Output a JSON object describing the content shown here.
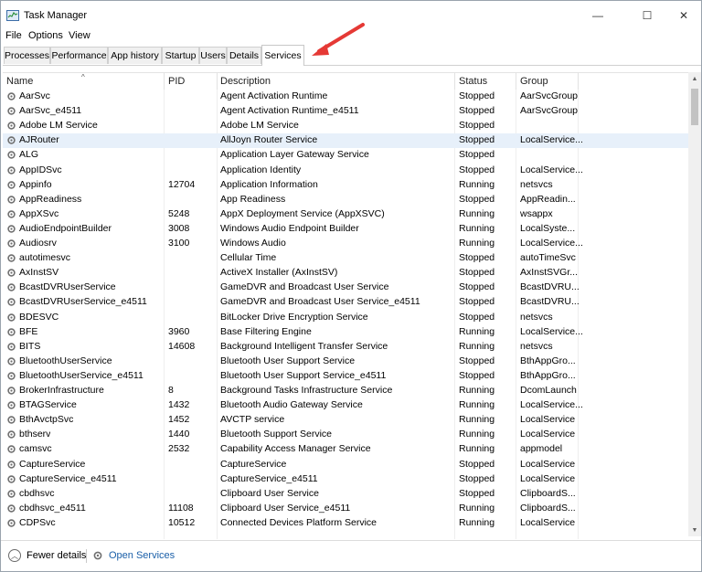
{
  "window": {
    "title": "Task Manager",
    "controls": {
      "minimize": "—",
      "maximize": "☐",
      "close": "✕"
    }
  },
  "menu": [
    "File",
    "Options",
    "View"
  ],
  "tabs": [
    "Processes",
    "Performance",
    "App history",
    "Startup",
    "Users",
    "Details",
    "Services"
  ],
  "active_tab": "Services",
  "columns": {
    "name": "Name",
    "pid": "PID",
    "description": "Description",
    "status": "Status",
    "group": "Group"
  },
  "services": [
    {
      "name": "AarSvc",
      "pid": "",
      "description": "Agent Activation Runtime",
      "status": "Stopped",
      "group": "AarSvcGroup"
    },
    {
      "name": "AarSvc_e4511",
      "pid": "",
      "description": "Agent Activation Runtime_e4511",
      "status": "Stopped",
      "group": "AarSvcGroup"
    },
    {
      "name": "Adobe LM Service",
      "pid": "",
      "description": "Adobe LM Service",
      "status": "Stopped",
      "group": ""
    },
    {
      "name": "AJRouter",
      "pid": "",
      "description": "AllJoyn Router Service",
      "status": "Stopped",
      "group": "LocalService..."
    },
    {
      "name": "ALG",
      "pid": "",
      "description": "Application Layer Gateway Service",
      "status": "Stopped",
      "group": ""
    },
    {
      "name": "AppIDSvc",
      "pid": "",
      "description": "Application Identity",
      "status": "Stopped",
      "group": "LocalService..."
    },
    {
      "name": "Appinfo",
      "pid": "12704",
      "description": "Application Information",
      "status": "Running",
      "group": "netsvcs"
    },
    {
      "name": "AppReadiness",
      "pid": "",
      "description": "App Readiness",
      "status": "Stopped",
      "group": "AppReadin..."
    },
    {
      "name": "AppXSvc",
      "pid": "5248",
      "description": "AppX Deployment Service (AppXSVC)",
      "status": "Running",
      "group": "wsappx"
    },
    {
      "name": "AudioEndpointBuilder",
      "pid": "3008",
      "description": "Windows Audio Endpoint Builder",
      "status": "Running",
      "group": "LocalSyste..."
    },
    {
      "name": "Audiosrv",
      "pid": "3100",
      "description": "Windows Audio",
      "status": "Running",
      "group": "LocalService..."
    },
    {
      "name": "autotimesvc",
      "pid": "",
      "description": "Cellular Time",
      "status": "Stopped",
      "group": "autoTimeSvc"
    },
    {
      "name": "AxInstSV",
      "pid": "",
      "description": "ActiveX Installer (AxInstSV)",
      "status": "Stopped",
      "group": "AxInstSVGr..."
    },
    {
      "name": "BcastDVRUserService",
      "pid": "",
      "description": "GameDVR and Broadcast User Service",
      "status": "Stopped",
      "group": "BcastDVRU..."
    },
    {
      "name": "BcastDVRUserService_e4511",
      "pid": "",
      "description": "GameDVR and Broadcast User Service_e4511",
      "status": "Stopped",
      "group": "BcastDVRU..."
    },
    {
      "name": "BDESVC",
      "pid": "",
      "description": "BitLocker Drive Encryption Service",
      "status": "Stopped",
      "group": "netsvcs"
    },
    {
      "name": "BFE",
      "pid": "3960",
      "description": "Base Filtering Engine",
      "status": "Running",
      "group": "LocalService..."
    },
    {
      "name": "BITS",
      "pid": "14608",
      "description": "Background Intelligent Transfer Service",
      "status": "Running",
      "group": "netsvcs"
    },
    {
      "name": "BluetoothUserService",
      "pid": "",
      "description": "Bluetooth User Support Service",
      "status": "Stopped",
      "group": "BthAppGro..."
    },
    {
      "name": "BluetoothUserService_e4511",
      "pid": "",
      "description": "Bluetooth User Support Service_e4511",
      "status": "Stopped",
      "group": "BthAppGro..."
    },
    {
      "name": "BrokerInfrastructure",
      "pid": "8",
      "description": "Background Tasks Infrastructure Service",
      "status": "Running",
      "group": "DcomLaunch"
    },
    {
      "name": "BTAGService",
      "pid": "1432",
      "description": "Bluetooth Audio Gateway Service",
      "status": "Running",
      "group": "LocalService..."
    },
    {
      "name": "BthAvctpSvc",
      "pid": "1452",
      "description": "AVCTP service",
      "status": "Running",
      "group": "LocalService"
    },
    {
      "name": "bthserv",
      "pid": "1440",
      "description": "Bluetooth Support Service",
      "status": "Running",
      "group": "LocalService"
    },
    {
      "name": "camsvc",
      "pid": "2532",
      "description": "Capability Access Manager Service",
      "status": "Running",
      "group": "appmodel"
    },
    {
      "name": "CaptureService",
      "pid": "",
      "description": "CaptureService",
      "status": "Stopped",
      "group": "LocalService"
    },
    {
      "name": "CaptureService_e4511",
      "pid": "",
      "description": "CaptureService_e4511",
      "status": "Stopped",
      "group": "LocalService"
    },
    {
      "name": "cbdhsvc",
      "pid": "",
      "description": "Clipboard User Service",
      "status": "Stopped",
      "group": "ClipboardS..."
    },
    {
      "name": "cbdhsvc_e4511",
      "pid": "11108",
      "description": "Clipboard User Service_e4511",
      "status": "Running",
      "group": "ClipboardS..."
    },
    {
      "name": "CDPSvc",
      "pid": "10512",
      "description": "Connected Devices Platform Service",
      "status": "Running",
      "group": "LocalService"
    }
  ],
  "selected_row": 3,
  "footer": {
    "fewer_details": "Fewer details",
    "open_services": "Open Services"
  },
  "annotation_arrow_color": "#e53935"
}
